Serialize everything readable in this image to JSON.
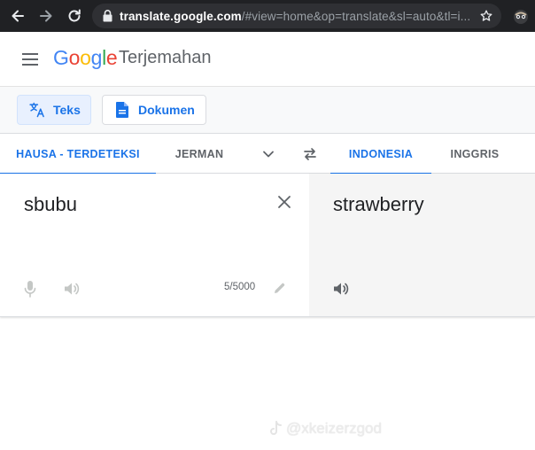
{
  "browser": {
    "url_host": "translate.google.com",
    "url_path": "/#view=home&op=translate&sl=auto&tl=i..."
  },
  "header": {
    "logo_letters": [
      {
        "ch": "G",
        "color": "#4285F4"
      },
      {
        "ch": "o",
        "color": "#EA4335"
      },
      {
        "ch": "o",
        "color": "#FBBC05"
      },
      {
        "ch": "g",
        "color": "#4285F4"
      },
      {
        "ch": "l",
        "color": "#34A853"
      },
      {
        "ch": "e",
        "color": "#EA4335"
      }
    ],
    "product_name": "Terjemahan"
  },
  "modes": {
    "text_label": "Teks",
    "documents_label": "Dokumen"
  },
  "languages": {
    "source_detected": "HAUSA - TERDETEKSI",
    "source_option": "JERMAN",
    "target_selected": "INDONESIA",
    "target_option": "INGGRIS"
  },
  "translation": {
    "source_text": "sbubu",
    "char_count": "5/5000",
    "target_text": "strawberry"
  },
  "watermark": {
    "text": "@xkeizerzgod"
  },
  "colors": {
    "accent": "#1a73e8",
    "chrome_bg": "#202124",
    "target_panel_bg": "#f5f5f5"
  }
}
